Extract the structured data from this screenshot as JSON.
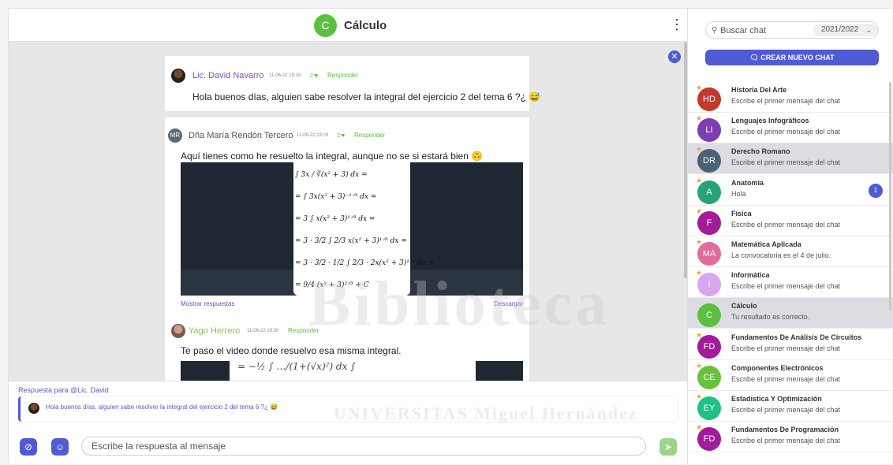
{
  "header": {
    "avatar_letter": "C",
    "title": "Cálculo",
    "menu_icon": "⋮"
  },
  "messages": [
    {
      "author": "Lic. David Navarro",
      "date": "11-06-22 19:18",
      "likes": "2",
      "reply_label": "Responder",
      "text": "Hola buenos días, alguien sabe resolver la integral del ejercicio 2 del tema 6 ?¿ 😅"
    },
    {
      "author": "Dña María Rendón Tercero",
      "avatar_initials": "MR",
      "date": "11-06-22 19:29",
      "likes": "2",
      "reply_label": "Responder",
      "text": "Aquí tienes como he resuelto la integral, aunque no se si estará bien 🙃",
      "math_lines": [
        "∫ 3x / ∛(x² + 3) dx =",
        "= ∫ 3x(x² + 3)⁻¹ᐟ³ dx =",
        "= 3 ∫ x(x² + 3)¹ᐟ³ dx =",
        "= 3 · 3/2 ∫ 2/3 x(x² + 3)¹ᐟ³ dx =",
        "= 3 · 3/2 · 1/2 ∫ 2/3 · 2x(x² + 3)¹ᐟ³ dx =",
        "= 9/4 (x² + 3)²ᐟ³ + C"
      ],
      "show_replies": "Mostrar respuestas",
      "download": "Descargar"
    },
    {
      "author": "Yago Herrero",
      "date": "11-06-22 19:30",
      "reply_label": "Responder",
      "text": "Te paso el video donde resuelvo esa misma integral."
    }
  ],
  "watermark": {
    "main": "Biblioteca",
    "sub": "UNIVERSITAS Miguel Hernández"
  },
  "reply": {
    "label": "Respuesta para @Lic. David",
    "quote": "Hola buenos días, alguien sabe resolver la integral del ejercicio 2 del tema 6 ?¿ 😅"
  },
  "composer": {
    "placeholder": "Escribe la respuesta al mensaje"
  },
  "sidebar": {
    "search_placeholder": "Buscar chat",
    "year": "2021/2022",
    "new_chat_label": "CREAR NUEVO CHAT",
    "chats": [
      {
        "initials": "HD",
        "name": "Historia Del Arte",
        "last": "Escribe el primer mensaje del chat",
        "color": "#c0392b",
        "starred": true
      },
      {
        "initials": "LI",
        "name": "Lenguajes Infográficos",
        "last": "Escribe el primer mensaje del chat",
        "color": "#7d3fb0",
        "starred": true
      },
      {
        "initials": "DR",
        "name": "Derecho Romano",
        "last": "Escribe el primer mensaje del chat",
        "color": "#4a6274",
        "starred": true,
        "selected": true
      },
      {
        "initials": "A",
        "name": "Anatomía",
        "last": "Hola",
        "color": "#27a37b",
        "starred": true,
        "badge": "1"
      },
      {
        "initials": "F",
        "name": "Física",
        "last": "Escribe el primer mensaje del chat",
        "color": "#a21c99",
        "starred": true
      },
      {
        "initials": "MA",
        "name": "Matemática Aplicada",
        "last": "La convocatoria es el 4 de julio.",
        "color": "#e06b9c",
        "starred": true
      },
      {
        "initials": "I",
        "name": "Informática",
        "last": "Escribe el primer mensaje del chat",
        "color": "#d8a5ee",
        "starred": true
      },
      {
        "initials": "C",
        "name": "Cálculo",
        "last": "Tu resultado es correcto.",
        "color": "#5cbf3f",
        "starred": false,
        "selected": true
      },
      {
        "initials": "FD",
        "name": "Fundamentos De Análisis De Circuitos",
        "last": "Escribe el primer mensaje del chat",
        "color": "#a21c99",
        "starred": true
      },
      {
        "initials": "CE",
        "name": "Componentes Electrónicos",
        "last": "Escribe el primer mensaje del chat",
        "color": "#6ac13b",
        "starred": true
      },
      {
        "initials": "EY",
        "name": "Estadística Y Optimización",
        "last": "Escribe el primer mensaje del chat",
        "color": "#1fbf86",
        "starred": true
      },
      {
        "initials": "FD",
        "name": "Fundamentos De Programación",
        "last": "Escribe el primer mensaje del chat",
        "color": "#a21c99",
        "starred": true
      }
    ]
  }
}
